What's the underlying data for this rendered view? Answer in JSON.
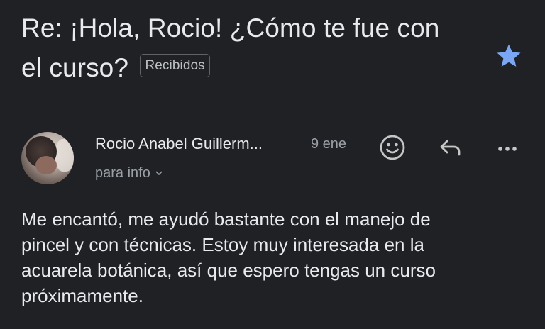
{
  "email": {
    "subject_line1": "Re: ¡Hola, Rocio! ¿Cómo te fue con",
    "subject_line2": "el curso?",
    "label": "Recibidos",
    "starred": true,
    "star_color": "#7aa7f5",
    "sender": {
      "name": "Rocio Anabel Guillerm...",
      "date": "9 ene",
      "recipient": "para info"
    },
    "actions": {
      "emoji_icon": "smiley-icon",
      "reply_icon": "reply-icon",
      "more_icon": "more-horiz-icon"
    },
    "body_lines": [
      "Me encantó, me ayudó bastante con el manejo de",
      "pincel y con técnicas. Estoy muy interesada en la",
      "acuarela botánica, así que espero tengas un curso",
      "próximamente."
    ]
  }
}
